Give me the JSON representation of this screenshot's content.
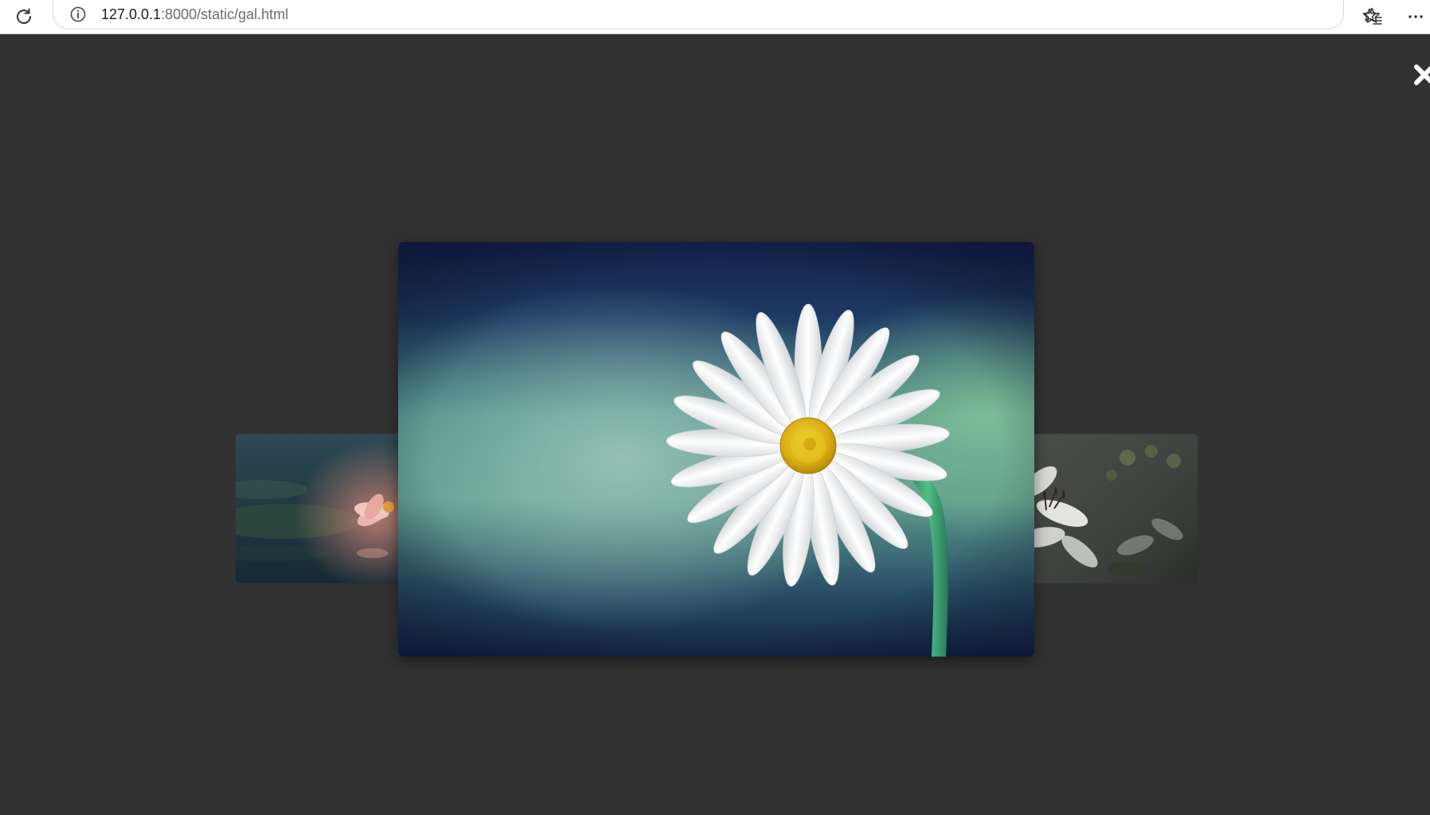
{
  "browser": {
    "url_host": "127.0.0.1",
    "url_path": ":8000/static/gal.html",
    "icons": {
      "reload": "reload-icon",
      "site_info": "info-icon",
      "bookmark": "star-icon",
      "favorites": "favorites-icon",
      "menu": "more-icon"
    }
  },
  "gallery": {
    "close_icon": "close-icon",
    "images": [
      {
        "subject": "lotus",
        "role": "previous"
      },
      {
        "subject": "daisy",
        "role": "current"
      },
      {
        "subject": "lily",
        "role": "next"
      }
    ]
  },
  "colors": {
    "backdrop": "#323232",
    "toolbar": "#ffffff"
  }
}
